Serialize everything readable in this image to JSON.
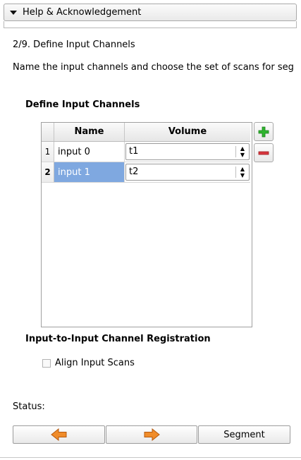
{
  "help": {
    "label": "Help & Acknowledgement"
  },
  "step": {
    "title": "2/9. Define Input Channels",
    "instructions": "Name the input channels and choose the set of scans for seg"
  },
  "channels": {
    "section_title": "Define Input Channels",
    "columns": {
      "name": "Name",
      "volume": "Volume"
    },
    "rows": [
      {
        "index": "1",
        "name": "input 0",
        "volume": "t1"
      },
      {
        "index": "2",
        "name": "input 1",
        "volume": "t2"
      }
    ],
    "selected_row": "2"
  },
  "registration": {
    "section_title": "Input-to-Input Channel Registration",
    "align_label": "Align Input Scans"
  },
  "status": {
    "label": "Status:"
  },
  "nav": {
    "segment_label": "Segment"
  },
  "icons": {
    "collapse": "triangle-down-icon",
    "add": "plus-icon",
    "remove": "minus-icon",
    "combo": "updown-arrows-icon",
    "back": "arrow-left-icon",
    "next": "arrow-right-icon"
  },
  "colors": {
    "selection": "#7fa8e0",
    "add_green": "#2fb52f",
    "remove_red": "#d9363e",
    "arrow_orange": "#f08c2a"
  }
}
